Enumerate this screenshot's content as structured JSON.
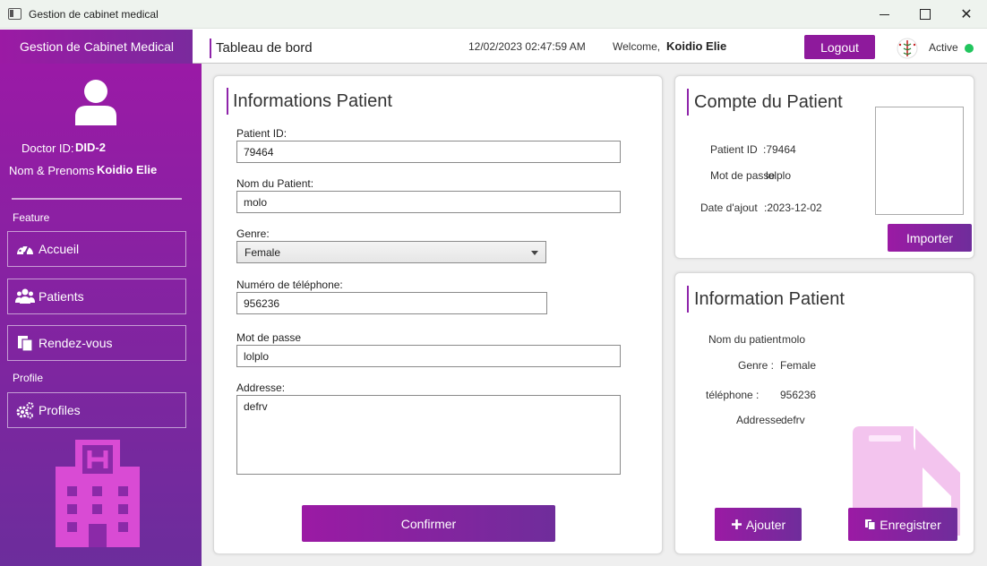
{
  "window": {
    "title": "Gestion de cabinet medical"
  },
  "header": {
    "brand": "Gestion de Cabinet Medical",
    "page_title": "Tableau de bord",
    "datetime": "12/02/2023 02:47:59 AM",
    "welcome_label": "Welcome,",
    "username": "Koidio Elie",
    "logout_label": "Logout",
    "status_label": "Active",
    "status_color": "#22c55e"
  },
  "sidebar": {
    "doctor_id_label": "Doctor ID:",
    "doctor_id": "DID-2",
    "name_label": "Nom & Prenoms",
    "name": "Koidio Elie",
    "feature_section": "Feature",
    "profile_section": "Profile",
    "items": [
      {
        "label": "Accueil",
        "icon": "dashboard-icon"
      },
      {
        "label": "Patients",
        "icon": "users-icon"
      },
      {
        "label": "Rendez-vous",
        "icon": "appointment-icon"
      },
      {
        "label": "Profiles",
        "icon": "gears-icon"
      }
    ]
  },
  "form": {
    "title": "Informations Patient",
    "patient_id_label": "Patient ID:",
    "patient_id": "79464",
    "name_label": "Nom du Patient:",
    "name": "molo",
    "gender_label": "Genre:",
    "gender": "Female",
    "phone_label": "Numéro de téléphone:",
    "phone": "956236",
    "password_label": "Mot de passe",
    "password": "lolplo",
    "address_label": "Addresse:",
    "address": "defrv",
    "confirm_label": "Confirmer"
  },
  "account": {
    "title": "Compte du Patient",
    "patient_id_label": "Patient ID",
    "patient_id": ":79464",
    "password_label": "Mot de passe",
    "password": "lolplo",
    "date_label": "Date d'ajout",
    "date": ":2023-12-02",
    "import_label": "Importer"
  },
  "info": {
    "title": "Information Patient",
    "name_label": "Nom du patient",
    "name": "molo",
    "gender_label": "Genre :",
    "gender": "Female",
    "phone_label": "téléphone :",
    "phone": "956236",
    "address_label": "Addresse",
    "address": "defrv",
    "add_label": "Ajouter",
    "save_label": "Enregistrer"
  },
  "colors": {
    "accent": "#8e24aa",
    "sidebar_top": "#9a1aa6",
    "sidebar_bottom": "#6c2d9c"
  }
}
